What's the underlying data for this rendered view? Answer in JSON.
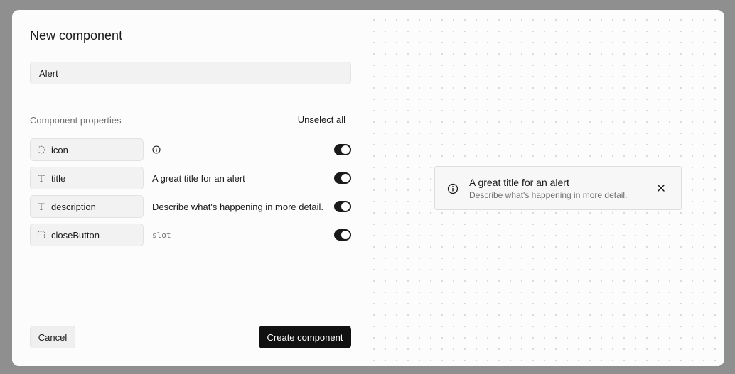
{
  "dialog": {
    "title": "New component",
    "name_value": "Alert"
  },
  "properties": {
    "header": "Component properties",
    "unselect_all": "Unselect all",
    "items": [
      {
        "name": "icon",
        "type_icon": "dashed-circle-icon",
        "value": "",
        "value_icon": "info-icon",
        "enabled": true
      },
      {
        "name": "title",
        "type_icon": "text-type-icon",
        "value": "A great title for an alert",
        "enabled": true
      },
      {
        "name": "description",
        "type_icon": "text-type-icon",
        "value": "Describe what's happening in more detail.",
        "enabled": true
      },
      {
        "name": "closeButton",
        "type_icon": "dashed-square-icon",
        "value": "slot",
        "enabled": true
      }
    ]
  },
  "actions": {
    "cancel": "Cancel",
    "create": "Create component"
  },
  "preview": {
    "title": "A great title for an alert",
    "description": "Describe what's happening in more detail.",
    "icon": "info-icon",
    "close_icon": "close-icon"
  },
  "colors": {
    "primary": "#111111",
    "toggle_on": "#1a1a1a",
    "muted_text": "#707070"
  }
}
